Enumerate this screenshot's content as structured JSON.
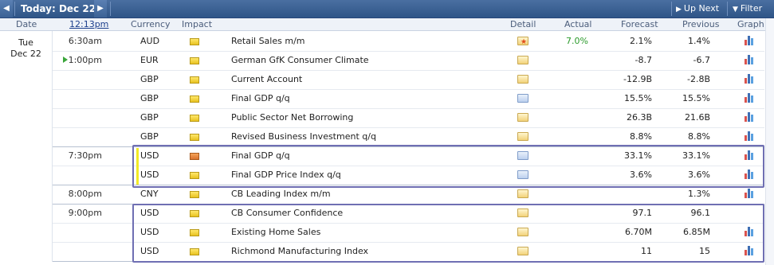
{
  "toolbar": {
    "today_label": "Today: Dec 22",
    "up_next_label": "Up Next",
    "filter_label": "Filter"
  },
  "header": {
    "date": "Date",
    "time": "12:13pm",
    "currency": "Currency",
    "impact": "Impact",
    "detail": "Detail",
    "actual": "Actual",
    "forecast": "Forecast",
    "previous": "Previous",
    "graph": "Graph"
  },
  "day": {
    "weekday": "Tue",
    "date": "Dec 22"
  },
  "events": [
    {
      "time": "6:30am",
      "currency": "AUD",
      "impact": "medium",
      "event": "Retail Sales m/m",
      "detail": "star",
      "actual": "7.0%",
      "forecast": "2.1%",
      "previous": "1.4%",
      "graph": true
    },
    {
      "time": "1:00pm",
      "currency": "EUR",
      "impact": "medium",
      "event": "German GfK Consumer Climate",
      "detail": "folder",
      "actual": "",
      "forecast": "-8.7",
      "previous": "-6.7",
      "graph": true,
      "upcoming": true
    },
    {
      "time": "",
      "currency": "GBP",
      "impact": "medium",
      "event": "Current Account",
      "detail": "folder",
      "actual": "",
      "forecast": "-12.9B",
      "previous": "-2.8B",
      "graph": true
    },
    {
      "time": "",
      "currency": "GBP",
      "impact": "medium",
      "event": "Final GDP q/q",
      "detail": "doc",
      "actual": "",
      "forecast": "15.5%",
      "previous": "15.5%",
      "graph": true
    },
    {
      "time": "",
      "currency": "GBP",
      "impact": "medium",
      "event": "Public Sector Net Borrowing",
      "detail": "folder",
      "actual": "",
      "forecast": "26.3B",
      "previous": "21.6B",
      "graph": true
    },
    {
      "time": "",
      "currency": "GBP",
      "impact": "medium",
      "event": "Revised Business Investment q/q",
      "detail": "folder",
      "actual": "",
      "forecast": "8.8%",
      "previous": "8.8%",
      "graph": true
    },
    {
      "time": "7:30pm",
      "currency": "USD",
      "impact": "high",
      "event": "Final GDP q/q",
      "detail": "doc",
      "actual": "",
      "forecast": "33.1%",
      "previous": "33.1%",
      "graph": true
    },
    {
      "time": "",
      "currency": "USD",
      "impact": "medium",
      "event": "Final GDP Price Index q/q",
      "detail": "doc",
      "actual": "",
      "forecast": "3.6%",
      "previous": "3.6%",
      "graph": true
    },
    {
      "time": "8:00pm",
      "currency": "CNY",
      "impact": "medium",
      "event": "CB Leading Index m/m",
      "detail": "folder",
      "actual": "",
      "forecast": "",
      "previous": "1.3%",
      "graph": true
    },
    {
      "time": "9:00pm",
      "currency": "USD",
      "impact": "medium",
      "event": "CB Consumer Confidence",
      "detail": "folder",
      "actual": "",
      "forecast": "97.1",
      "previous": "96.1",
      "graph": false
    },
    {
      "time": "",
      "currency": "USD",
      "impact": "medium",
      "event": "Existing Home Sales",
      "detail": "folder",
      "actual": "",
      "forecast": "6.70M",
      "previous": "6.85M",
      "graph": true
    },
    {
      "time": "",
      "currency": "USD",
      "impact": "medium",
      "event": "Richmond Manufacturing Index",
      "detail": "folder",
      "actual": "",
      "forecast": "11",
      "previous": "15",
      "graph": true
    }
  ],
  "colors": {
    "toolbar": "#2f5587",
    "actual_text": "#2a9a2a",
    "highlight_box": "#6f6fb3"
  }
}
